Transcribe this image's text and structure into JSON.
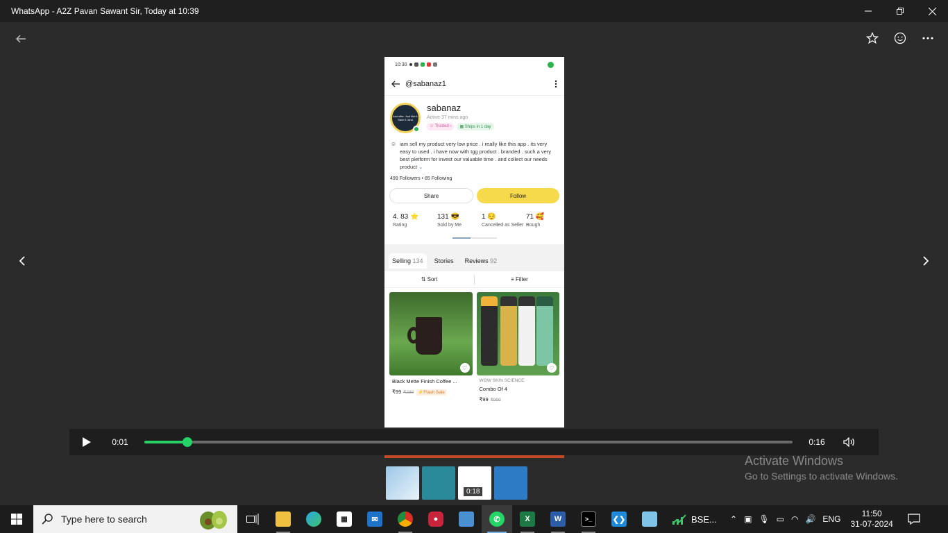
{
  "window": {
    "title": "WhatsApp - A2Z Pavan Sawant Sir, Today at 10:39",
    "minimize_icon": "minimize-icon",
    "maximize_icon": "restore-icon",
    "close_icon": "close-icon"
  },
  "viewer": {
    "back_icon": "arrow-left-icon",
    "star_icon": "star-icon",
    "emoji_icon": "smiley-icon",
    "more_icon": "more-horizontal-icon",
    "prev_icon": "chevron-left-icon",
    "next_icon": "chevron-right-icon"
  },
  "phone": {
    "status_time": "10:30",
    "handle": "@sabanaz1",
    "avatar_text": "Just offer. Jsut like it. Save it. kind",
    "name": "sabanaz",
    "active": "Active 37 mins ago",
    "badge_trusted": "☺ Trusted ›",
    "badge_ships": "▦ Ships in 1 day",
    "bio": "iam sell my product very low price .  i really like this app . its very easy to used .   i have now with tgg product . branded  . such a very best pletform for invest our valuable time . and collect our needs product",
    "followers": "499",
    "followers_label": "Followers",
    "following": "85",
    "following_label": "Following",
    "share_label": "Share",
    "follow_label": "Follow",
    "stats": [
      {
        "num": "4. 83 ⭐",
        "label": "Rating"
      },
      {
        "num": "131 😎",
        "label": "Sold by Me"
      },
      {
        "num": "1 😔",
        "label": "Cancelled as Seller"
      },
      {
        "num": "71 🥰",
        "label": "Bough"
      }
    ],
    "tabs": [
      {
        "label": "Selling",
        "count": "134"
      },
      {
        "label": "Stories",
        "count": ""
      },
      {
        "label": "Reviews",
        "count": "92"
      }
    ],
    "sort_label": "⇅  Sort",
    "filter_label": "≡  Filter",
    "products": [
      {
        "brand": "",
        "title": "Black Mette Finish Coffee ...",
        "price": "₹99",
        "old_price": "₹299",
        "flash": "⚡Flash Sale"
      },
      {
        "brand": "WOW SKIN SCIENCE",
        "title": "Combo Of 4",
        "price": "₹99",
        "old_price": "₹999",
        "flash": ""
      }
    ]
  },
  "player": {
    "play_icon": "play-icon",
    "current_time": "0:01",
    "duration": "0:16",
    "progress": 0.066,
    "volume_icon": "volume-icon"
  },
  "thumbnails": [
    {
      "label": ""
    },
    {
      "label": ""
    },
    {
      "label": "0:18"
    },
    {
      "label": ""
    }
  ],
  "activation": {
    "line1": "Activate Windows",
    "line2": "Go to Settings to activate Windows."
  },
  "taskbar": {
    "search_placeholder": "Type here to search",
    "bse_label": "BSE...",
    "language": "ENG",
    "time": "11:50",
    "date": "31-07-2024"
  },
  "colors": {
    "accent_green": "#25d366",
    "follow_yellow": "#f7d94c"
  }
}
